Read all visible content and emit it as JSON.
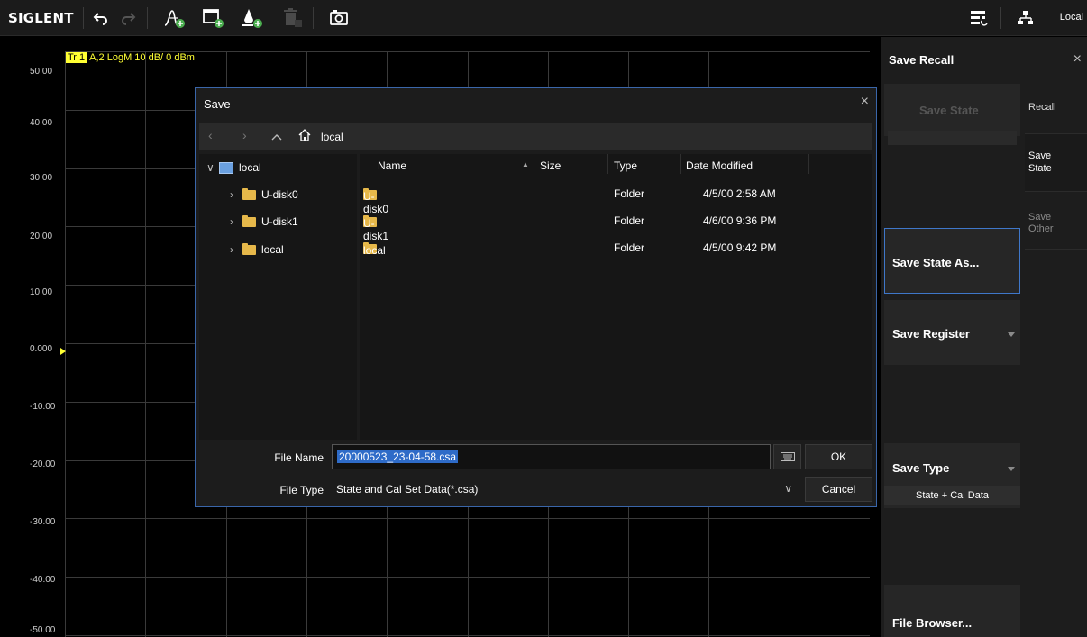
{
  "toolbar": {
    "brand": "SIGLENT",
    "icons": [
      "undo-icon",
      "redo-icon",
      "add-trace-icon",
      "add-window-icon",
      "add-channel-icon",
      "delete-icon",
      "camera-icon"
    ],
    "right_icons": [
      "menu-config-icon",
      "network-icon"
    ],
    "connection": "Local"
  },
  "plot": {
    "trace": {
      "tag": "Tr 1",
      "description": "A,2 LogM 10 dB/ 0 dBm",
      "color": "#ffff33"
    },
    "y_ticks": [
      "50.00",
      "40.00",
      "30.00",
      "20.00",
      "10.00",
      "0.000",
      "-10.00",
      "-20.00",
      "-30.00",
      "-40.00",
      "-50.00"
    ],
    "grid_color": "#3a3a3a"
  },
  "panel": {
    "title": "Save Recall",
    "close": "×",
    "softkeys": {
      "save_state": "Save State",
      "save_state_as": "Save State As...",
      "save_register": "Save Register",
      "save_type": "Save Type",
      "save_type_value": "State + Cal Data",
      "file_browser": "File Browser..."
    },
    "tabs": {
      "recall": "Recall",
      "save_state": "Save State",
      "save_other": "Save Other"
    },
    "accent": "#3f77c9"
  },
  "dialog": {
    "title": "Save",
    "close": "×",
    "path": "local",
    "tree": [
      {
        "label": "local",
        "expanded": true
      },
      {
        "label": "U-disk0",
        "expanded": false
      },
      {
        "label": "U-disk1",
        "expanded": false
      },
      {
        "label": "local",
        "expanded": false
      }
    ],
    "columns": {
      "name": "Name",
      "size": "Size",
      "type": "Type",
      "date": "Date Modified"
    },
    "files": [
      {
        "name": "U-disk0",
        "type": "Folder",
        "date": "4/5/00 2:58 AM"
      },
      {
        "name": "U-disk1",
        "type": "Folder",
        "date": "4/6/00 9:36 PM"
      },
      {
        "name": "local",
        "type": "Folder",
        "date": "4/5/00 9:42 PM"
      }
    ],
    "file_name_label": "File Name",
    "file_name_value": "20000523_23-04-58.csa",
    "file_type_label": "File Type",
    "file_type_value": "State and Cal Set Data(*.csa)",
    "ok": "OK",
    "cancel": "Cancel"
  }
}
